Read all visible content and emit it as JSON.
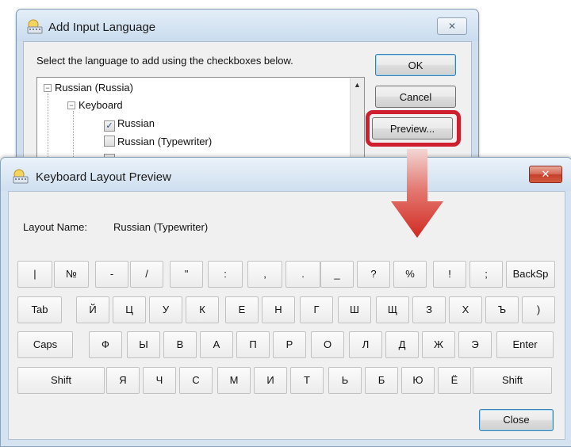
{
  "add_language_dialog": {
    "title": "Add Input Language",
    "close_label": "✕",
    "instruction": "Select the language to add using the checkboxes below.",
    "tree": {
      "language": "Russian (Russia)",
      "group": "Keyboard",
      "items": [
        {
          "label": "Russian",
          "checked": true
        },
        {
          "label": "Russian (Typewriter)",
          "checked": false
        }
      ]
    },
    "buttons": {
      "ok": "OK",
      "cancel": "Cancel",
      "preview": "Preview..."
    },
    "highlight_color": "#cf1f2e"
  },
  "preview_dialog": {
    "title": "Keyboard Layout Preview",
    "close_label": "✕",
    "layout_name_label": "Layout Name:",
    "layout_name_value": "Russian (Typewriter)",
    "keyboard_rows": [
      [
        "|",
        "№",
        "-",
        "/",
        "\"",
        ":",
        ",",
        ".",
        "_",
        "?",
        "%",
        "!",
        ";",
        "BackSp"
      ],
      [
        "Tab",
        "Й",
        "Ц",
        "У",
        "К",
        "Е",
        "Н",
        "Г",
        "Ш",
        "Щ",
        "З",
        "Х",
        "Ъ",
        ")"
      ],
      [
        "Caps",
        "Ф",
        "Ы",
        "В",
        "А",
        "П",
        "Р",
        "О",
        "Л",
        "Д",
        "Ж",
        "Э",
        "Enter"
      ],
      [
        "Shift",
        "Я",
        "Ч",
        "С",
        "М",
        "И",
        "Т",
        "Ь",
        "Б",
        "Ю",
        "Ё",
        "Shift"
      ]
    ],
    "close_button": "Close"
  },
  "annotation": {
    "arrow_color": "#d8332c"
  }
}
